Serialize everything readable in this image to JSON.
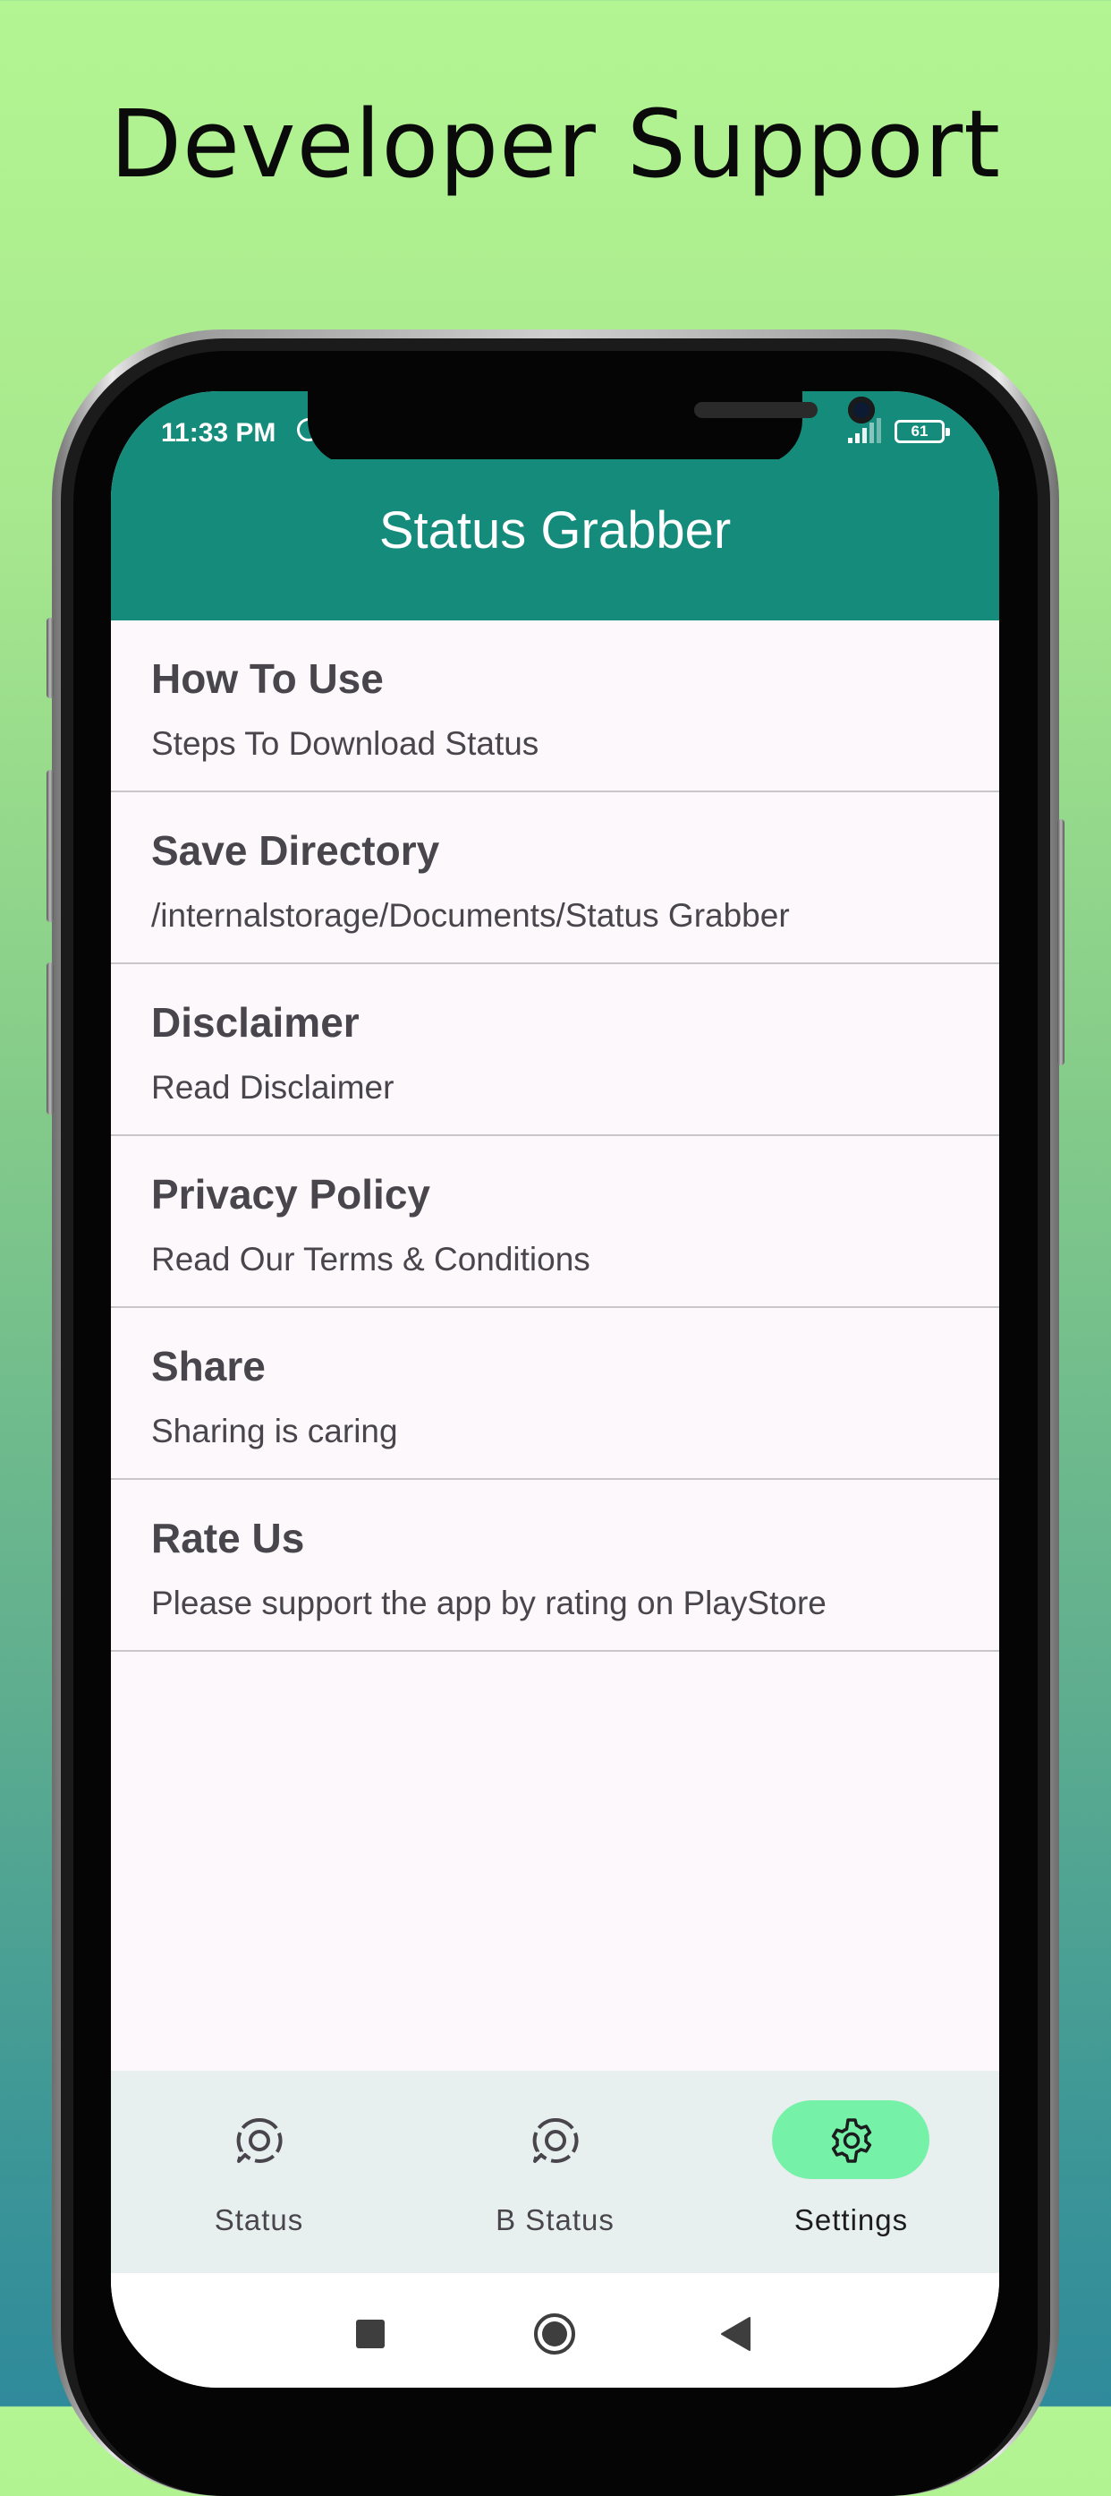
{
  "headline": "Developer Support",
  "status_bar": {
    "time": "11:33 PM",
    "battery": "61"
  },
  "app_bar": {
    "title": "Status Grabber"
  },
  "settings": {
    "items": [
      {
        "title": "How To Use",
        "subtitle": "Steps To Download Status"
      },
      {
        "title": "Save Directory",
        "subtitle": "/internalstorage/Documents/Status Grabber"
      },
      {
        "title": "Disclaimer",
        "subtitle": "Read Disclaimer"
      },
      {
        "title": "Privacy Policy",
        "subtitle": "Read Our Terms & Conditions"
      },
      {
        "title": "Share",
        "subtitle": "Sharing is caring"
      },
      {
        "title": "Rate Us",
        "subtitle": "Please support the app by rating on PlayStore"
      }
    ]
  },
  "bottom_nav": {
    "items": [
      {
        "label": "Status",
        "icon": "status-chat-icon",
        "active": false
      },
      {
        "label": "B Status",
        "icon": "status-chat-icon",
        "active": false
      },
      {
        "label": "Settings",
        "icon": "gear-icon",
        "active": true
      }
    ]
  },
  "colors": {
    "primary": "#148b7b",
    "active_pill": "#76f2a8",
    "nav_background": "#e8efef",
    "screen_background": "#fdf8fb",
    "text": "#48464c"
  },
  "system_nav": {
    "icons": [
      "recents-square-icon",
      "home-circle-icon",
      "back-triangle-icon"
    ]
  }
}
